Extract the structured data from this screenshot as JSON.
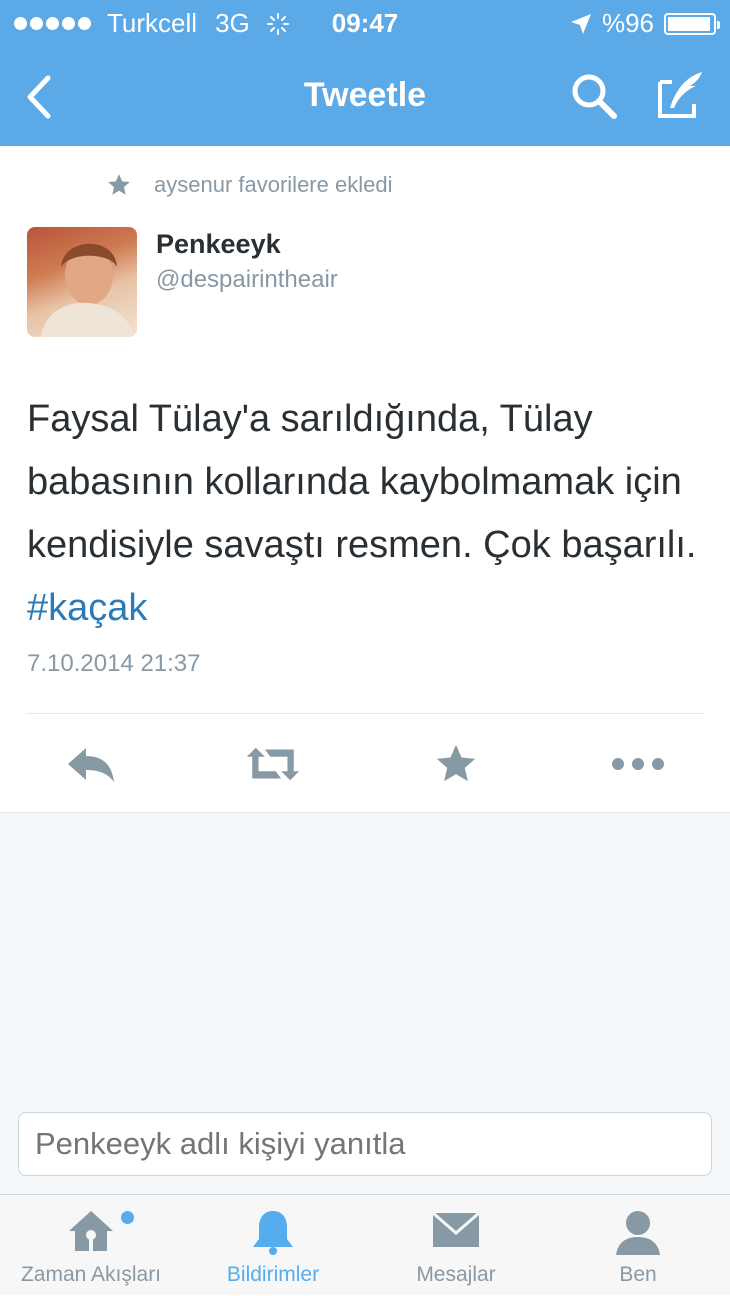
{
  "status_bar": {
    "carrier": "Turkcell",
    "network": "3G",
    "time": "09:47",
    "battery": "%96",
    "battery_level": 0.96
  },
  "nav": {
    "title": "Tweetle"
  },
  "tweet": {
    "context": "aysenur favorilere ekledi",
    "author_name": "Penkeeyk",
    "author_handle": "@despairintheair",
    "text": "Faysal Tülay'a sarıldığında, Tülay babasının kollarında kaybolmamak için kendisiyle savaştı resmen. Çok başarılı. ",
    "hashtag": "#kaçak",
    "timestamp": "7.10.2014 21:37"
  },
  "reply": {
    "placeholder": "Penkeeyk adlı kişiyi yanıtla"
  },
  "tabs": [
    {
      "label": "Zaman Akışları",
      "icon": "home-icon"
    },
    {
      "label": "Bildirimler",
      "icon": "bell-icon"
    },
    {
      "label": "Mesajlar",
      "icon": "envelope-icon"
    },
    {
      "label": "Ben",
      "icon": "person-icon"
    }
  ],
  "colors": {
    "header": "#5ca9e8",
    "accent": "#55acee",
    "hashtag": "#2b7bb9",
    "muted": "#8899a6"
  }
}
